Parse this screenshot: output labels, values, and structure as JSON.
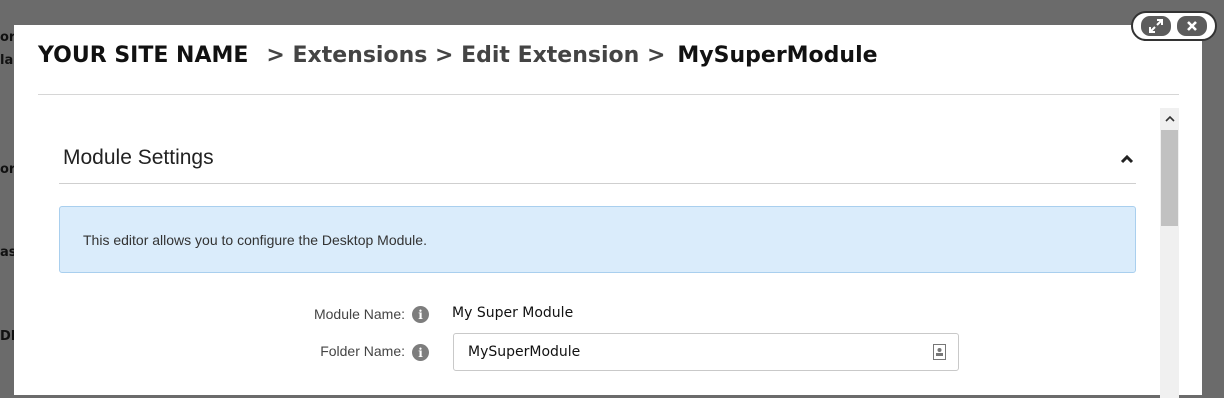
{
  "backdrop": {
    "fragments": [
      "or",
      "la",
      "or",
      "as",
      "DI"
    ]
  },
  "header": {
    "site_name": "YOUR SITE NAME",
    "crumbs": "> Extensions > Edit Extension >",
    "current": "MySuperModule"
  },
  "window_controls": {
    "expand_icon": "expand-icon",
    "close_icon": "close-icon"
  },
  "section": {
    "title": "Module Settings",
    "toggle_icon": "chevron-up-icon",
    "info": "This editor allows you to configure the Desktop Module."
  },
  "form": {
    "module_name_label": "Module Name:",
    "module_name_value": "My Super Module",
    "folder_name_label": "Folder Name:",
    "folder_name_value": "MySuperModule"
  },
  "colors": {
    "info_bg": "#daecfb",
    "info_border": "#a9cfee",
    "overlay": "#6b6b6b"
  }
}
